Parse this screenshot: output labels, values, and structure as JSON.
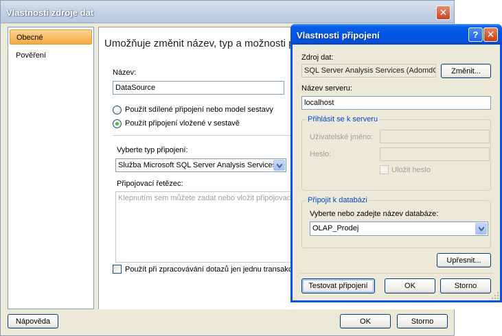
{
  "outer_dialog": {
    "title": "Vlastnosti zdroje dat",
    "nav_items": [
      "Obecné",
      "Pověření"
    ],
    "heading": "Umožňuje změnit název, typ a možnosti p",
    "name_label": "Název:",
    "name_value": "DataSource",
    "radio_shared_label": "Použít sdílené připojení nebo model sestavy",
    "radio_embedded_label": "Použít připojení vložené v sestavě",
    "connection_type_label": "Vyberte typ připojení:",
    "connection_type_value": "Služba Microsoft SQL Server Analysis Services",
    "connection_string_label": "Připojovací řetězec:",
    "connection_string_placeholder": "Klepnutím sem můžete zadat nebo vložit připojovací ř",
    "single_transaction_label": "Použít při zpracovávání dotazů jen jednu transakci",
    "help_button": "Nápověda",
    "ok_button": "OK",
    "cancel_button": "Storno"
  },
  "inner_dialog": {
    "title": "Vlastnosti připojení",
    "data_source_label": "Zdroj dat:",
    "data_source_value": "SQL Server Analysis Services (AdomdC",
    "change_button": "Změnit...",
    "server_name_label": "Název serveru:",
    "server_name_value": "localhost",
    "login_group_title": "Přihlásit se k serveru",
    "username_label": "Uživatelské jméno:",
    "password_label": "Heslo:",
    "save_password_label": "Uložit heslo",
    "db_group_title": "Připojit k databázi",
    "db_select_label": "Vyberte nebo zadejte název databáze:",
    "db_value": "OLAP_Prodej",
    "advanced_button": "Upřesnit...",
    "test_button": "Testovat připojení",
    "ok_button": "OK",
    "cancel_button": "Storno"
  }
}
